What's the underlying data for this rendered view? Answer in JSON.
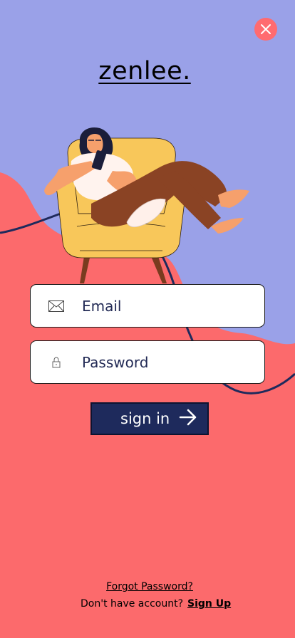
{
  "app": {
    "logo_text": "zenlee."
  },
  "close": {
    "icon": "close-icon"
  },
  "form": {
    "email_label": "Email",
    "email_icon": "mail-icon",
    "password_label": "Password",
    "password_icon": "lock-icon"
  },
  "actions": {
    "signin_label": "sign in",
    "signin_icon": "arrow-right-icon",
    "forgot_label": "Forgot Password?",
    "no_account_text": "Don't have account?",
    "signup_label": "Sign Up"
  },
  "colors": {
    "lavender_bg": "#9aa1e8",
    "coral_bg": "#fc6a6c",
    "navy": "#1e2a5c",
    "close_bg": "#ff6b70"
  }
}
